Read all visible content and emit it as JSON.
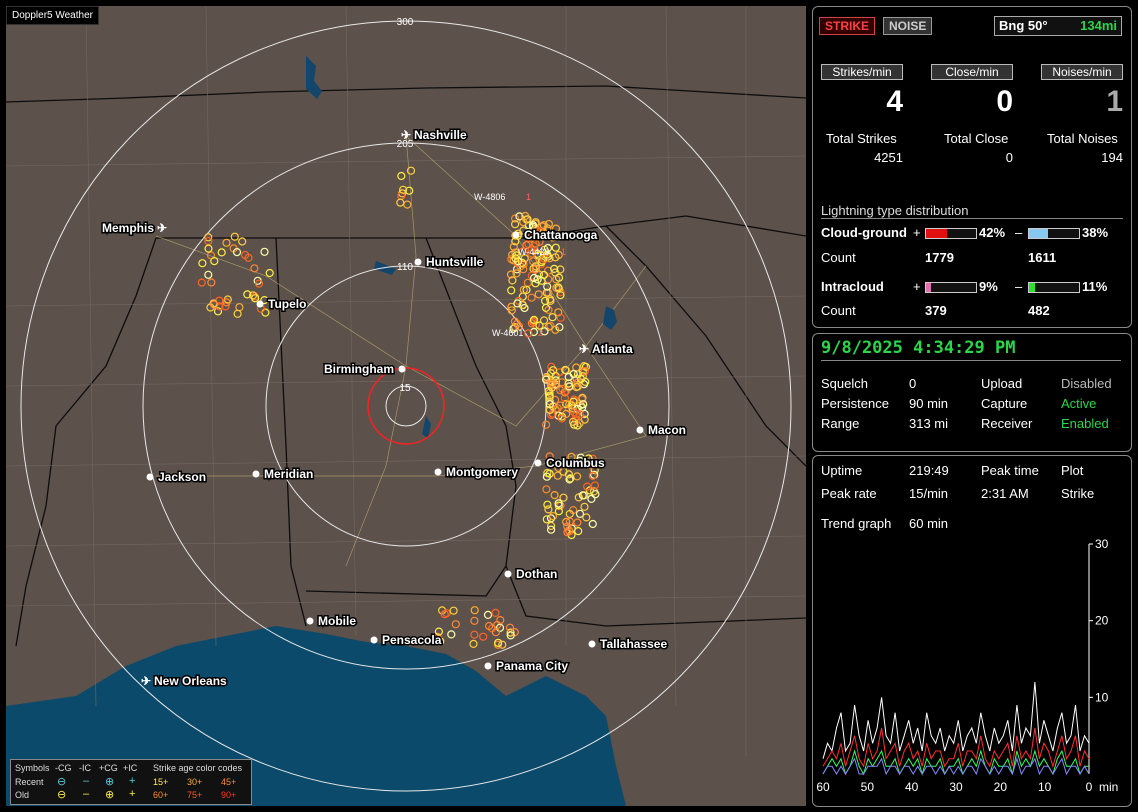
{
  "app": {
    "title": "Doppler5 Weather"
  },
  "map": {
    "range_labels": [
      "300",
      "205",
      "110",
      "15"
    ],
    "cities": [
      {
        "name": "Nashville",
        "airport": true
      },
      {
        "name": "Memphis",
        "airport": true
      },
      {
        "name": "Chattanooga",
        "airport": false
      },
      {
        "name": "Huntsville",
        "airport": false
      },
      {
        "name": "Tupelo",
        "airport": false
      },
      {
        "name": "Atlanta",
        "airport": true
      },
      {
        "name": "Birmingham",
        "airport": false
      },
      {
        "name": "Macon",
        "airport": false
      },
      {
        "name": "Jackson",
        "airport": false
      },
      {
        "name": "Meridian",
        "airport": false
      },
      {
        "name": "Montgomery",
        "airport": false
      },
      {
        "name": "Columbus",
        "airport": false
      },
      {
        "name": "Dothan",
        "airport": false
      },
      {
        "name": "Mobile",
        "airport": false
      },
      {
        "name": "Pensacola",
        "airport": false
      },
      {
        "name": "Tallahassee",
        "airport": false
      },
      {
        "name": "Panama City",
        "airport": false
      },
      {
        "name": "New Orleans",
        "airport": true
      }
    ],
    "storm_labels": [
      "W-4806",
      "1",
      "W-4429",
      "1",
      "W-4601",
      "2"
    ]
  },
  "legend": {
    "symbols_label": "Symbols",
    "cols": [
      "-CG",
      "-IC",
      "+CG",
      "+IC"
    ],
    "recent_label": "Recent",
    "old_label": "Old",
    "age_title": "Strike age color codes",
    "ages_recent": [
      "15+",
      "30+",
      "45+"
    ],
    "ages_old": [
      "60+",
      "75+",
      "90+"
    ]
  },
  "panel": {
    "strike_btn": "STRIKE",
    "noise_btn": "NOISE",
    "bearing": "Bng 50°",
    "distance": "134mi",
    "strikes_min_label": "Strikes/min",
    "close_min_label": "Close/min",
    "noises_min_label": "Noises/min",
    "strikes_min": "4",
    "close_min": "0",
    "noises_min": "1",
    "total_strikes_label": "Total Strikes",
    "total_close_label": "Total Close",
    "total_noises_label": "Total Noises",
    "total_strikes": "4251",
    "total_close": "0",
    "total_noises": "194",
    "dist_title": "Lightning type distribution",
    "cg_label": "Cloud-ground",
    "ic_label": "Intracloud",
    "count_label": "Count",
    "plus": "+",
    "minus": "–",
    "cg_plus_pct": "42%",
    "cg_minus_pct": "38%",
    "cg_plus_count": "1779",
    "cg_minus_count": "1611",
    "ic_plus_pct": "9%",
    "ic_minus_pct": "11%",
    "ic_plus_count": "379",
    "ic_minus_count": "482",
    "cg_plus_frac": 0.42,
    "cg_minus_frac": 0.38,
    "ic_plus_frac": 0.09,
    "ic_minus_frac": 0.11
  },
  "status": {
    "datetime": "9/8/2025 4:34:29 PM",
    "squelch_label": "Squelch",
    "squelch": "0",
    "persistence_label": "Persistence",
    "persistence": "90 min",
    "range_label": "Range",
    "range": "313 mi",
    "upload_label": "Upload",
    "upload": "Disabled",
    "capture_label": "Capture",
    "capture": "Active",
    "receiver_label": "Receiver",
    "receiver": "Enabled"
  },
  "stats": {
    "uptime_label": "Uptime",
    "uptime": "219:49",
    "peak_time_label": "Peak time",
    "peak_time": "2:31 AM",
    "plot_label": "Plot",
    "plot": "Strike",
    "peak_rate_label": "Peak rate",
    "peak_rate": "15/min",
    "trend_label": "Trend graph",
    "trend": "60 min"
  },
  "chart_data": {
    "type": "line",
    "xlabel": "min",
    "x_ticks": [
      "60",
      "50",
      "40",
      "30",
      "20",
      "10",
      "0"
    ],
    "y_ticks": [
      "30",
      "20",
      "10"
    ],
    "ylim": [
      0,
      30
    ],
    "xlim": [
      60,
      0
    ],
    "series": [
      {
        "color": "#ffffff",
        "values": [
          2,
          4,
          3,
          6,
          8,
          3,
          4,
          9,
          5,
          3,
          7,
          4,
          6,
          10,
          5,
          4,
          8,
          3,
          5,
          7,
          4,
          6,
          3,
          8,
          5,
          4,
          6,
          3,
          5,
          4,
          7,
          3,
          5,
          6,
          4,
          8,
          5,
          3,
          6,
          4,
          5,
          7,
          3,
          9,
          4,
          6,
          5,
          12,
          4,
          7,
          5,
          3,
          6,
          8,
          4,
          5,
          9,
          3,
          5,
          4
        ]
      },
      {
        "color": "#ff3030",
        "values": [
          1,
          2,
          3,
          2,
          4,
          1,
          3,
          5,
          2,
          1,
          4,
          2,
          3,
          6,
          2,
          3,
          4,
          1,
          3,
          4,
          2,
          3,
          1,
          4,
          2,
          3,
          3,
          1,
          2,
          2,
          4,
          1,
          3,
          3,
          2,
          5,
          2,
          1,
          3,
          2,
          3,
          4,
          1,
          5,
          2,
          3,
          2,
          6,
          2,
          4,
          3,
          1,
          3,
          5,
          2,
          3,
          5,
          1,
          3,
          2
        ]
      },
      {
        "color": "#30ff60",
        "values": [
          0,
          1,
          2,
          1,
          2,
          0,
          1,
          3,
          1,
          0,
          2,
          1,
          2,
          3,
          1,
          1,
          2,
          0,
          1,
          2,
          1,
          2,
          0,
          2,
          1,
          1,
          2,
          0,
          1,
          1,
          2,
          0,
          1,
          2,
          1,
          3,
          1,
          0,
          2,
          1,
          1,
          2,
          0,
          3,
          1,
          2,
          1,
          3,
          1,
          2,
          1,
          0,
          2,
          3,
          1,
          1,
          2,
          0,
          1,
          1
        ]
      },
      {
        "color": "#8888ff",
        "values": [
          0,
          1,
          1,
          0,
          1,
          0,
          1,
          2,
          0,
          0,
          1,
          1,
          1,
          2,
          0,
          1,
          1,
          0,
          1,
          1,
          0,
          1,
          0,
          1,
          1,
          0,
          1,
          0,
          1,
          0,
          1,
          0,
          1,
          1,
          0,
          2,
          1,
          0,
          1,
          0,
          1,
          1,
          0,
          2,
          0,
          1,
          1,
          2,
          0,
          1,
          1,
          0,
          1,
          2,
          0,
          1,
          1,
          0,
          1,
          0
        ]
      }
    ]
  }
}
